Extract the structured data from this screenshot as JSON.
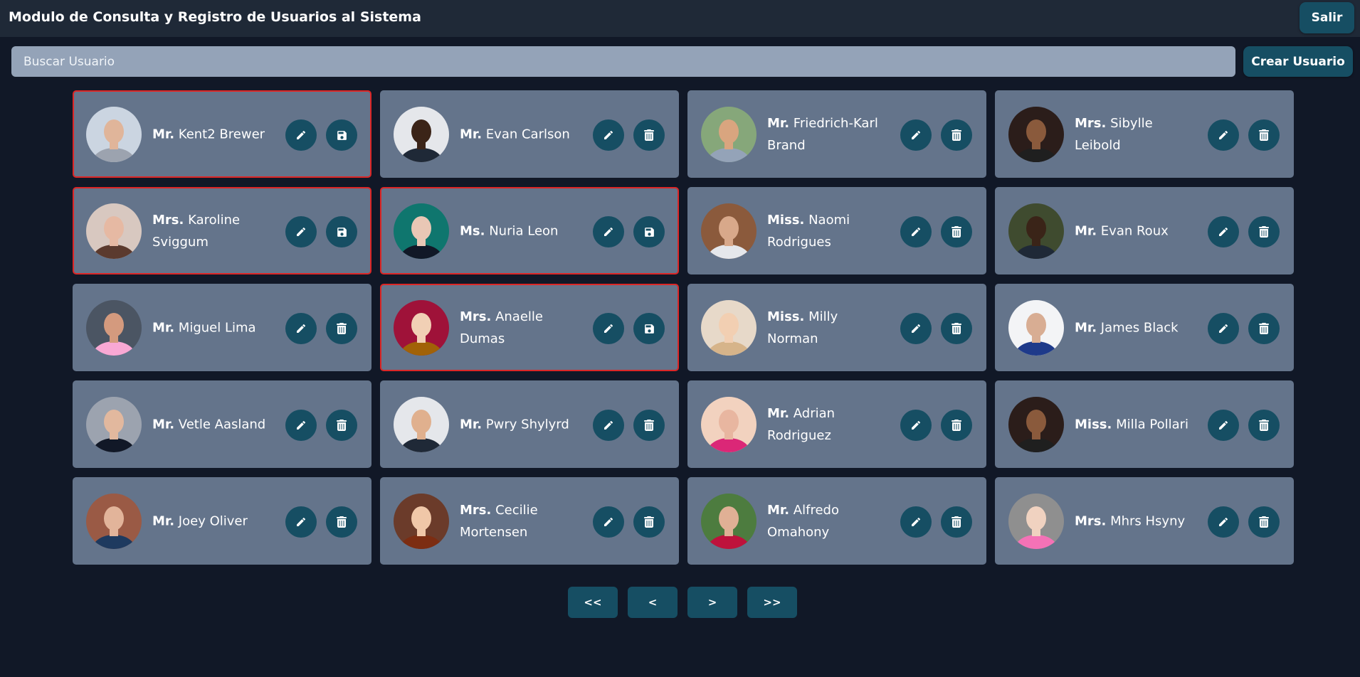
{
  "header": {
    "title": "Modulo de Consulta y Registro de Usuarios al Sistema",
    "logout_label": "Salir"
  },
  "search": {
    "placeholder": "Buscar Usuario",
    "value": ""
  },
  "create_button_label": "Crear Usuario",
  "colors": {
    "background": "#111827",
    "header": "#1f2937",
    "card": "#64748b",
    "button": "#164e63",
    "editing_border": "#dc2626",
    "search": "#94a3b8"
  },
  "users": [
    {
      "title": "Mr.",
      "name": "Kent2 Brewer",
      "editing": true,
      "action_icon": "save-icon",
      "avatar_bg": "#cbd5e1",
      "avatar_skin": "#e0b59a",
      "avatar_shirt": "#9ca3af"
    },
    {
      "title": "Mr.",
      "name": "Evan Carlson",
      "editing": false,
      "action_icon": "trash-icon",
      "avatar_bg": "#e5e7eb",
      "avatar_skin": "#3b2418",
      "avatar_shirt": "#1f2937"
    },
    {
      "title": "Mr.",
      "name": "Friedrich-Karl Brand",
      "editing": false,
      "action_icon": "trash-icon",
      "avatar_bg": "#86a77a",
      "avatar_skin": "#d9a57f",
      "avatar_shirt": "#94a3b8"
    },
    {
      "title": "Mrs.",
      "name": "Sibylle Leibold",
      "editing": false,
      "action_icon": "trash-icon",
      "avatar_bg": "#2b1d1a",
      "avatar_skin": "#8a5a3c",
      "avatar_shirt": "#1f1f1f"
    },
    {
      "title": "Mrs.",
      "name": "Karoline Sviggum",
      "editing": true,
      "action_icon": "save-icon",
      "avatar_bg": "#d8c8c0",
      "avatar_skin": "#e6b9a3",
      "avatar_shirt": "#5b3a2e"
    },
    {
      "title": "Ms.",
      "name": "Nuria Leon",
      "editing": true,
      "action_icon": "save-icon",
      "avatar_bg": "#0f766e",
      "avatar_skin": "#e9c7b5",
      "avatar_shirt": "#111827"
    },
    {
      "title": "Miss.",
      "name": "Naomi Rodrigues",
      "editing": false,
      "action_icon": "trash-icon",
      "avatar_bg": "#8b5a3c",
      "avatar_skin": "#d8a88a",
      "avatar_shirt": "#e5e7eb"
    },
    {
      "title": "Mr.",
      "name": "Evan Roux",
      "editing": false,
      "action_icon": "trash-icon",
      "avatar_bg": "#3f4b2f",
      "avatar_skin": "#3a2418",
      "avatar_shirt": "#1f2937"
    },
    {
      "title": "Mr.",
      "name": "Miguel Lima",
      "editing": false,
      "action_icon": "trash-icon",
      "avatar_bg": "#4b5563",
      "avatar_skin": "#d49a7e",
      "avatar_shirt": "#f9a8d4"
    },
    {
      "title": "Mrs.",
      "name": "Anaelle Dumas",
      "editing": true,
      "action_icon": "save-icon",
      "avatar_bg": "#9f1239",
      "avatar_skin": "#f1d0b5",
      "avatar_shirt": "#a16207"
    },
    {
      "title": "Miss.",
      "name": "Milly Norman",
      "editing": false,
      "action_icon": "trash-icon",
      "avatar_bg": "#e7d9c9",
      "avatar_skin": "#f2cfb2",
      "avatar_shirt": "#d6b48a"
    },
    {
      "title": "Mr.",
      "name": "James Black",
      "editing": false,
      "action_icon": "trash-icon",
      "avatar_bg": "#f3f4f6",
      "avatar_skin": "#d8ad93",
      "avatar_shirt": "#1e3a8a"
    },
    {
      "title": "Mr.",
      "name": "Vetle Aasland",
      "editing": false,
      "action_icon": "trash-icon",
      "avatar_bg": "#9ca3af",
      "avatar_skin": "#e2b89e",
      "avatar_shirt": "#111827"
    },
    {
      "title": "Mr.",
      "name": "Pwry Shylyrd",
      "editing": false,
      "action_icon": "trash-icon",
      "avatar_bg": "#e5e7eb",
      "avatar_skin": "#e0b08e",
      "avatar_shirt": "#1f2937"
    },
    {
      "title": "Mr.",
      "name": "Adrian Rodriguez",
      "editing": false,
      "action_icon": "trash-icon",
      "avatar_bg": "#f2d2bf",
      "avatar_skin": "#e8b6a0",
      "avatar_shirt": "#db2777"
    },
    {
      "title": "Miss.",
      "name": "Milla Pollari",
      "editing": false,
      "action_icon": "trash-icon",
      "avatar_bg": "#2b1d1a",
      "avatar_skin": "#8a5a3c",
      "avatar_shirt": "#1f1f1f"
    },
    {
      "title": "Mr.",
      "name": "Joey Oliver",
      "editing": false,
      "action_icon": "trash-icon",
      "avatar_bg": "#9a5a45",
      "avatar_skin": "#e2b49a",
      "avatar_shirt": "#1e3a5f"
    },
    {
      "title": "Mrs.",
      "name": "Cecilie Mortensen",
      "editing": false,
      "action_icon": "trash-icon",
      "avatar_bg": "#6b3b2a",
      "avatar_skin": "#f0c7a8",
      "avatar_shirt": "#7c2d12"
    },
    {
      "title": "Mr.",
      "name": "Alfredo Omahony",
      "editing": false,
      "action_icon": "trash-icon",
      "avatar_bg": "#4d7c3f",
      "avatar_skin": "#e0b095",
      "avatar_shirt": "#be123c"
    },
    {
      "title": "Mrs.",
      "name": "Mhrs Hsyny",
      "editing": false,
      "action_icon": "trash-icon",
      "avatar_bg": "#8f8f8f",
      "avatar_skin": "#f0d2c0",
      "avatar_shirt": "#f472b6"
    }
  ],
  "pagination": {
    "first": "<<",
    "prev": "<",
    "next": ">",
    "last": ">>"
  }
}
